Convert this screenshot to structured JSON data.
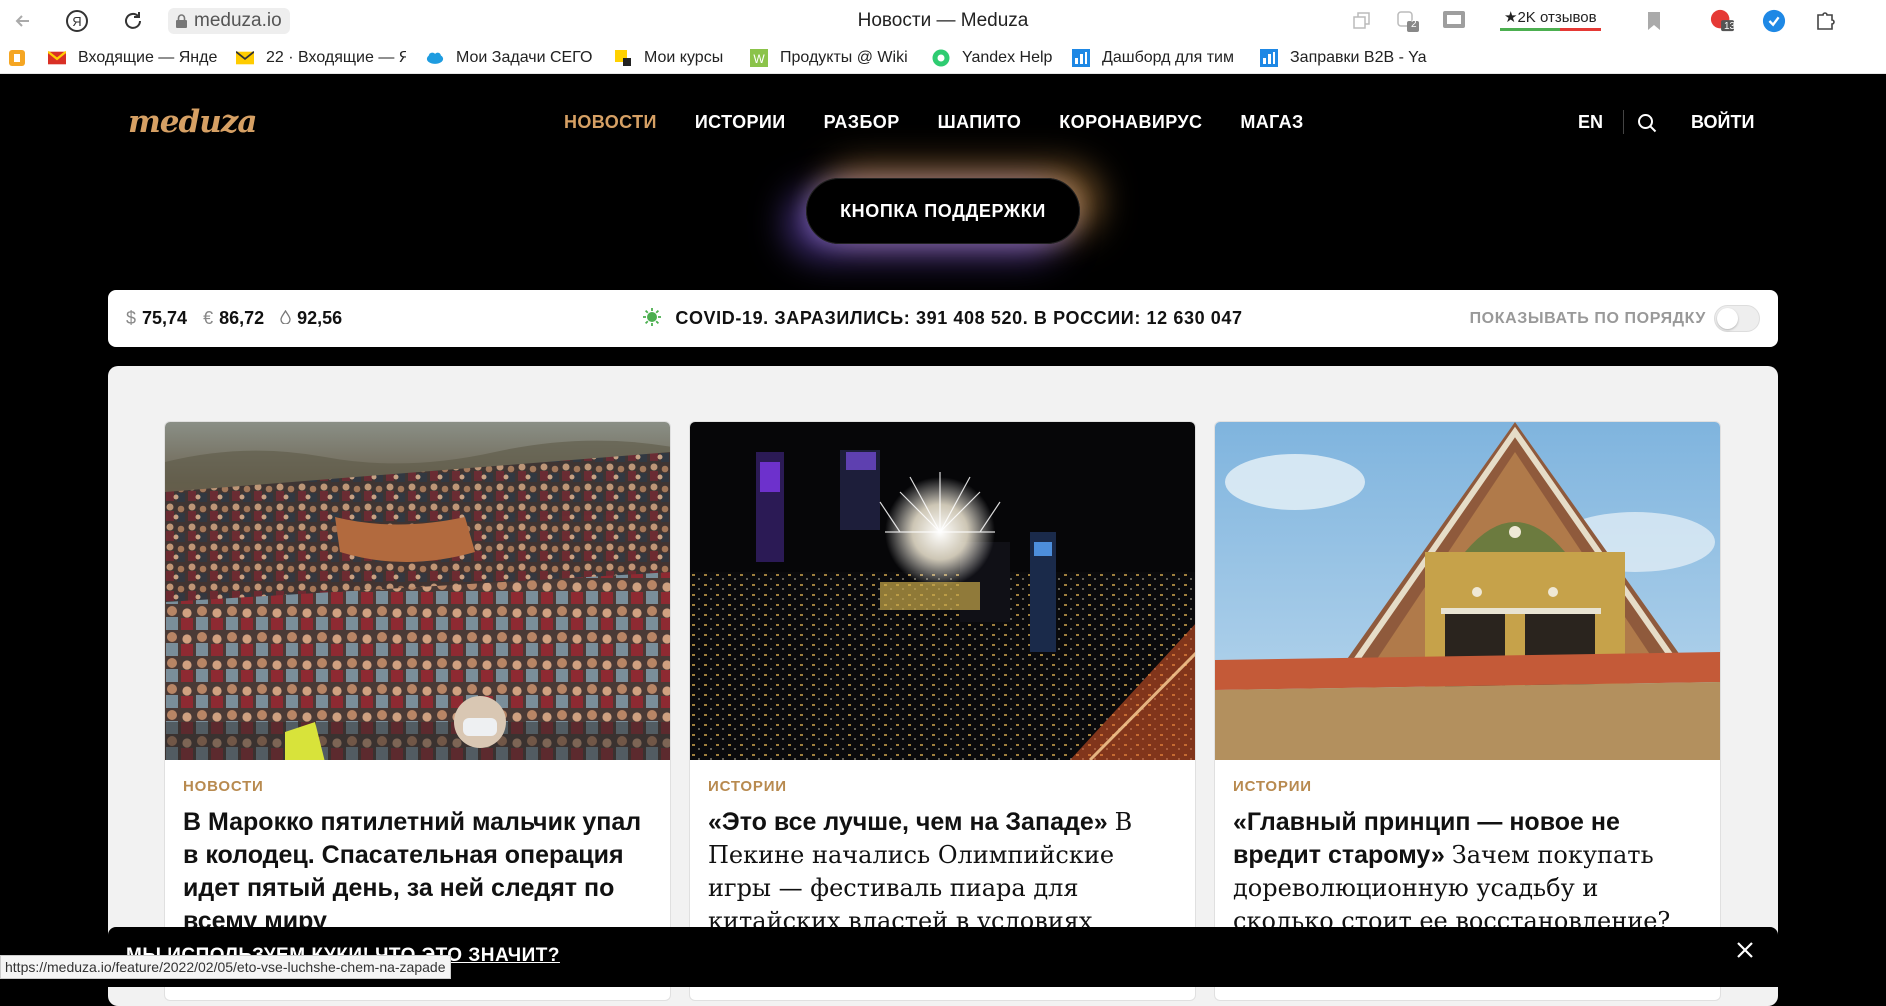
{
  "browser": {
    "address": "meduza.io",
    "tab_title": "Новости — Meduza",
    "reviews_label": "★2K отзывов",
    "ext_badge_1": "2",
    "ext_badge_2": "13"
  },
  "bookmarks": [
    {
      "label": "Входящие — Янде",
      "icon": "mail-icon"
    },
    {
      "label": "22 · Входящие — Я",
      "icon": "mail-icon"
    },
    {
      "label": "Мои Задачи СЕГО",
      "icon": "cloud-icon"
    },
    {
      "label": "Мои курсы",
      "icon": "course-icon"
    },
    {
      "label": "Продукты @ Wiki",
      "icon": "wiki-icon"
    },
    {
      "label": "Yandex Help",
      "icon": "help-icon"
    },
    {
      "label": "Дашборд для тим",
      "icon": "chart-icon"
    },
    {
      "label": "Заправки B2B - Ya",
      "icon": "chart-icon"
    }
  ],
  "site": {
    "logo": "meduza",
    "nav": [
      "НОВОСТИ",
      "ИСТОРИИ",
      "РАЗБОР",
      "ШАПИТО",
      "КОРОНАВИРУС",
      "МАГАЗ"
    ],
    "lang": "EN",
    "login": "ВОЙТИ",
    "support_button": "КНОПКА ПОДДЕРЖКИ"
  },
  "infobar": {
    "usd": "75,74",
    "eur": "86,72",
    "oil": "92,56",
    "covid": "COVID-19. ЗАРАЗИЛИСЬ: 391 408 520. В РОССИИ: 12 630 047",
    "order_label": "ПОКАЗЫВАТЬ ПО ПОРЯДКУ"
  },
  "cards": [
    {
      "rubric": "НОВОСТИ",
      "title": "В Марокко пятилетний мальчик упал в колодец. Спасательная операция идет пятый день, за ней следят по всему миру",
      "subtitle": ""
    },
    {
      "rubric": "ИСТОРИИ",
      "title": "«Это все лучше, чем на Западе»",
      "subtitle": "В Пекине начались Олимпийские игры — фестиваль пиара для китайских властей в условиях"
    },
    {
      "rubric": "ИСТОРИИ",
      "title": "«Главный принцип — новое не вредит старому»",
      "subtitle": "Зачем покупать дореволюционную усадьбу и сколько стоит ее восстановление?"
    }
  ],
  "banner": {
    "text": "МЫ ИСПОЛЬЗУЕМ КУКИ! ЧТО ЭТО ЗНАЧИТ?"
  },
  "status_url": "https://meduza.io/feature/2022/02/05/eto-vse-luchshe-chem-na-zapade"
}
